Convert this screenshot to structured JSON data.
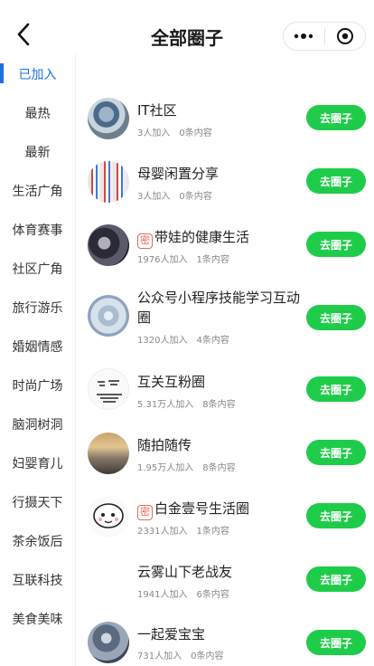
{
  "header": {
    "title": "全部圈子",
    "back_icon": "chevron-left-icon",
    "more_icon": "more-dots-icon",
    "close_icon": "target-circle-icon"
  },
  "sidebar": {
    "items": [
      {
        "label": "已加入",
        "active": true
      },
      {
        "label": "最热"
      },
      {
        "label": "最新"
      },
      {
        "label": "生活广角"
      },
      {
        "label": "体育赛事"
      },
      {
        "label": "社区广角"
      },
      {
        "label": "旅行游乐"
      },
      {
        "label": "婚姻情感"
      },
      {
        "label": "时尚广场"
      },
      {
        "label": "脑洞树洞"
      },
      {
        "label": "妇婴育儿"
      },
      {
        "label": "行摄天下"
      },
      {
        "label": "茶余饭后"
      },
      {
        "label": "互联科技"
      },
      {
        "label": "美食美味"
      }
    ]
  },
  "secret_badge": "密",
  "circles": [
    {
      "name": "IT社区",
      "members": "3人加入",
      "posts": "0条内容",
      "button": "去圈子",
      "secret": false
    },
    {
      "name": "母婴闲置分享",
      "members": "3人加入",
      "posts": "0条内容",
      "button": "去圈子",
      "secret": false
    },
    {
      "name": "带娃的健康生活",
      "members": "1976人加入",
      "posts": "1条内容",
      "button": "去圈子",
      "secret": true
    },
    {
      "name": "公众号小程序技能学习互动圈",
      "members": "1320人加入",
      "posts": "4条内容",
      "button": "去圈子",
      "secret": false
    },
    {
      "name": "互关互粉圈",
      "members": "5.31万人加入",
      "posts": "8条内容",
      "button": "去圈子",
      "secret": false
    },
    {
      "name": "随拍随传",
      "members": "1.95万人加入",
      "posts": "8条内容",
      "button": "去圈子",
      "secret": false
    },
    {
      "name": "白金壹号生活圈",
      "members": "2331人加入",
      "posts": "1条内容",
      "button": "去圈子",
      "secret": true
    },
    {
      "name": "云雾山下老战友",
      "members": "1941人加入",
      "posts": "6条内容",
      "button": "去圈子",
      "secret": false
    },
    {
      "name": "一起爱宝宝",
      "members": "731人加入",
      "posts": "0条内容",
      "button": "去圈子",
      "secret": false
    }
  ],
  "colors": {
    "accent_blue": "#1f6fe5",
    "join_green": "#1fcc4a",
    "secret_red": "#e26a59"
  }
}
